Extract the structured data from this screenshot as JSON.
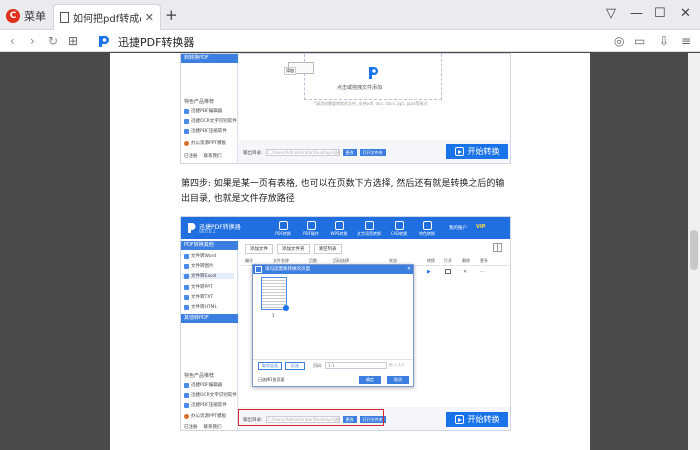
{
  "browser": {
    "menu_label": "菜单",
    "menu_logo": "C",
    "tab_title": "如何把pdf转成excel? .pdf",
    "tab_close": "✕",
    "new_tab": "+",
    "site_title": "迅捷PDF转换器"
  },
  "app_top": {
    "side_top_label": "到转换PDF",
    "side_heading": "特色产品推荐",
    "side_items": [
      "迅捷PDF编辑器",
      "迅捷OCR文字识别软件",
      "迅捷PDF压缩软件",
      "办公资源PPT模板"
    ],
    "bottom_links": [
      "已注册",
      "联系我们"
    ],
    "drop_hint": "点击或拖拽文件添加",
    "format_hint": "*请添加需要转换的文件, 支持pdf, doc, docx, ppt, pptx等格式",
    "output_label": "输出目录:",
    "output_path": "C:/Users/Administrator/Desktop/迅捷PDF转换器",
    "change_btn": "更改",
    "open_btn": "打开文件夹",
    "start_label": "开始转换",
    "badge": "添加"
  },
  "paragraph": "第四步: 如果是某一页有表格, 也可以在页数下方选择, 然后还有就是转换之后的输出目录, 也就是文件存放路径",
  "app_bottom": {
    "title": "迅捷PDF转换器",
    "version": "v8.0.0.1",
    "tools": [
      "PDF转换",
      "PDF操作",
      "WPS转换",
      "文字语音转换",
      "CAD转换",
      "特色转换"
    ],
    "user": "我的账户",
    "vip": "VIP",
    "side_top_label": "PDF转换其他",
    "side_items": [
      "文件转Word",
      "文件转图片",
      "文件转Excel",
      "文件转PPT",
      "文件转TXT",
      "文件转HTML"
    ],
    "side_second": "其他转PDF",
    "side_heading": "特色产品推荐",
    "side_items2": [
      "迅捷PDF编辑器",
      "迅捷OCR文字识别软件",
      "迅捷PDF压缩软件",
      "办公资源PPT模板"
    ],
    "bottom_links": [
      "已注册",
      "联系我们"
    ],
    "toolbar": [
      "添加文件",
      "添加文件夹",
      "清空列表"
    ],
    "columns": [
      "编号",
      "文件名称",
      "页数",
      "页码选择",
      "状态",
      "转换",
      "打开",
      "删除",
      "更多"
    ],
    "dialog_title": "请勾选需要转换的页面",
    "thumb_number": "1",
    "select_all": "取消全选",
    "invert": "反选",
    "pages_label": "页码:",
    "pages_value": "1-1",
    "pages_hint": "例: 1,3-5",
    "selected_info": "已选择1张页面",
    "ok": "确定",
    "cancel": "取消",
    "output_label": "输出目录:",
    "output_path": "C:/Users/Administrator/Desktop/迅捷PDF转换器",
    "change_btn": "更改",
    "open_btn": "打开文件夹",
    "start_label": "开始转换"
  }
}
